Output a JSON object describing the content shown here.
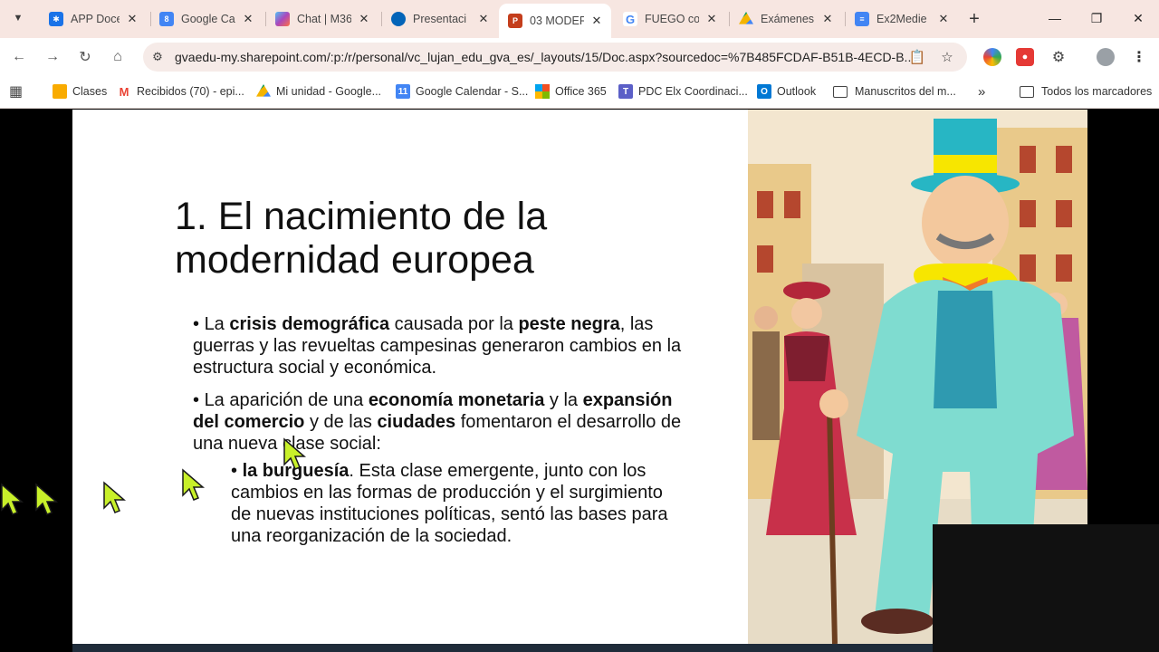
{
  "tabs": [
    {
      "title": "APP Docen",
      "icon": "app-icon",
      "color": "#1a73e8"
    },
    {
      "title": "Google Ca",
      "icon": "google-calendar-icon",
      "color": "#4285f4",
      "badge": "8"
    },
    {
      "title": "Chat | M36",
      "icon": "copilot-icon",
      "color": "#7b61ff"
    },
    {
      "title": "Presentaci",
      "icon": "onedrive-icon",
      "color": "#0364b8"
    },
    {
      "title": "03 MODER",
      "icon": "powerpoint-icon",
      "color": "#c43e1c",
      "active": true
    },
    {
      "title": "FUEGO co",
      "icon": "google-icon",
      "color": "#4285f4"
    },
    {
      "title": "Exámenes",
      "icon": "google-drive-icon",
      "color": "#0f9d58"
    },
    {
      "title": "Ex2Medie",
      "icon": "google-docs-icon",
      "color": "#4285f4"
    }
  ],
  "url": "gvaedu-my.sharepoint.com/:p:/r/personal/vc_lujan_edu_gva_es/_layouts/15/Doc.aspx?sourcedoc=%7B485FCDAF-B51B-4ECD-B...",
  "bookmarks": [
    {
      "label": "Clases",
      "icon": "folder-icon"
    },
    {
      "label": "Recibidos (70) - epi...",
      "icon": "gmail-icon"
    },
    {
      "label": "Mi unidad - Google...",
      "icon": "google-drive-icon"
    },
    {
      "label": "Google Calendar - S...",
      "icon": "google-calendar-icon"
    },
    {
      "label": "Office 365",
      "icon": "office-icon"
    },
    {
      "label": "PDC Elx Coordinaci...",
      "icon": "teams-icon"
    },
    {
      "label": "Outlook",
      "icon": "outlook-icon"
    },
    {
      "label": "Manuscritos del m...",
      "icon": "folder-icon"
    }
  ],
  "bookmarks_more": "»",
  "all_bookmarks": "Todos los marcadores",
  "slide": {
    "title_line1": "1. El nacimiento de la",
    "title_line2": "modernidad europea",
    "bullet1": {
      "p1": "La ",
      "b1": "crisis demográfica",
      "p2": " causada por la ",
      "b2": "peste negra",
      "p3": ", las guerras y las revueltas campesinas generaron cambios en la estructura social y económica."
    },
    "bullet2": {
      "p1": "La aparición de una ",
      "b1": "economía monetaria",
      "p2": " y la ",
      "b2": "expansión del comercio",
      "p3": " y de las ",
      "b3": "ciudades",
      "p4": " fomentaron el desarrollo de una nueva clase social:"
    },
    "sub_bullet": {
      "b1": "la burguesía",
      "p1": ". Esta clase emergente, junto con los cambios en las formas de producción y el surgimiento de nuevas instituciones políticas, sentó las bases para una reorganización de la sociedad."
    }
  },
  "colors": {
    "tabstrip": "#f7e6e1",
    "cursor": "#c8f02a"
  }
}
